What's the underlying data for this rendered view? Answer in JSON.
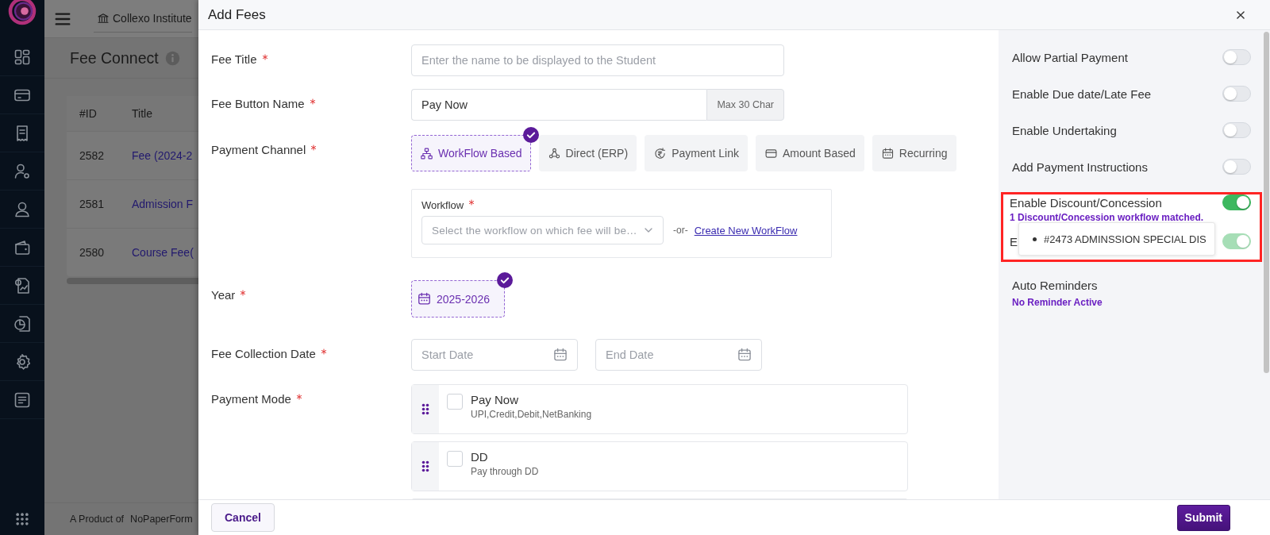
{
  "background_page": {
    "institute": "Collexo Institute",
    "page_title": "Fee Connect",
    "table": {
      "columns": [
        "#ID",
        "Title"
      ],
      "rows": [
        {
          "id": "2582",
          "title": "Fee (2024-2"
        },
        {
          "id": "2581",
          "title": "Admission F"
        },
        {
          "id": "2580",
          "title": "Course Fee("
        }
      ]
    },
    "footer": {
      "text": "A Product of",
      "brand": "NoPaperForm"
    }
  },
  "modal": {
    "title": "Add Fees",
    "fee_title": {
      "label": "Fee Title",
      "required": true,
      "placeholder": "Enter the name to be displayed to the Student"
    },
    "fee_button_name": {
      "label": "Fee Button Name",
      "required": true,
      "value": "Pay Now",
      "addon": "Max 30 Char"
    },
    "payment_channel": {
      "label": "Payment Channel",
      "required": true,
      "options": [
        {
          "label": "WorkFlow Based",
          "selected": true
        },
        {
          "label": "Direct (ERP)",
          "selected": false
        },
        {
          "label": "Payment Link",
          "selected": false
        },
        {
          "label": "Amount Based",
          "selected": false
        },
        {
          "label": "Recurring",
          "selected": false
        }
      ],
      "workflow": {
        "label": "Workflow",
        "required": true,
        "placeholder": "Select the workflow on which fee will be…",
        "separator": "-or-",
        "link": "Create New WorkFlow"
      }
    },
    "year": {
      "label": "Year",
      "required": true,
      "options": [
        {
          "label": "2025-2026",
          "selected": true
        }
      ]
    },
    "fee_collection_date": {
      "label": "Fee Collection Date",
      "required": true,
      "start_placeholder": "Start Date",
      "end_placeholder": "End Date"
    },
    "payment_mode": {
      "label": "Payment Mode",
      "required": true,
      "modes": [
        {
          "name": "Pay Now",
          "description": "UPI,Credit,Debit,NetBanking",
          "checked": false
        },
        {
          "name": "DD",
          "description": "Pay through DD",
          "checked": false
        }
      ]
    },
    "settings": [
      {
        "kind": "toggle",
        "label": "Allow Partial Payment",
        "on": false
      },
      {
        "kind": "toggle",
        "label": "Enable Due date/Late Fee",
        "on": false
      },
      {
        "kind": "toggle",
        "label": "Enable Undertaking",
        "on": false
      },
      {
        "kind": "toggle",
        "label": "Add Payment Instructions",
        "on": false
      },
      {
        "kind": "discount",
        "label": "Enable Discount/Concession",
        "on": true,
        "note": "1 Discount/Concession workflow matched.",
        "matches": [
          "#2473 ADMINSSION SPECIAL DIS"
        ],
        "covered_row": {
          "label": "E",
          "on": true,
          "disabled": true
        }
      },
      {
        "kind": "info",
        "label": "Auto Reminders",
        "status": "No Reminder Active"
      }
    ],
    "buttons": {
      "cancel": "Cancel",
      "submit": "Submit"
    }
  }
}
